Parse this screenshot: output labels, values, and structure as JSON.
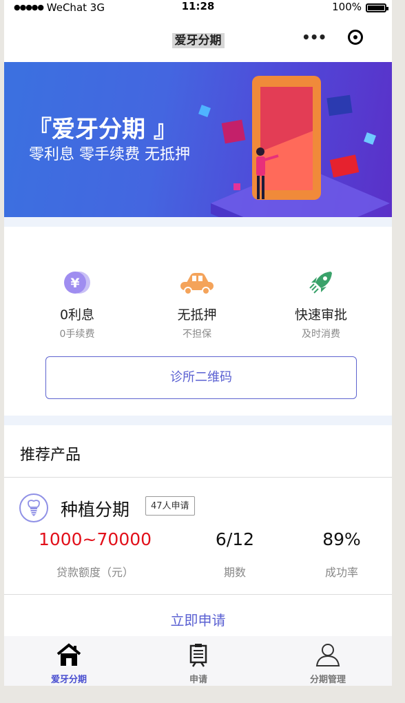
{
  "status_bar": {
    "signal_dots": "●●●●●",
    "carrier": "WeChat 3G",
    "time": "11:28",
    "battery": "100%"
  },
  "nav": {
    "title": "爱牙分期",
    "more_icon": "more-dots-icon",
    "close_icon": "close-circle-icon"
  },
  "banner": {
    "title": "『爱牙分期 』",
    "subtitle": "零利息 零手续费 无抵押",
    "colors": {
      "from": "#3b71e0",
      "to": "#5a30c8"
    }
  },
  "features": [
    {
      "icon": "yen-coin-icon",
      "title": "0利息",
      "subtitle": "0手续费",
      "color": "#9f8df0"
    },
    {
      "icon": "car-icon",
      "title": "无抵押",
      "subtitle": "不担保",
      "color": "#f4a35a"
    },
    {
      "icon": "rocket-icon",
      "title": "快速审批",
      "subtitle": "及时消费",
      "color": "#3aa26a"
    }
  ],
  "qr_button": {
    "label": "诊所二维码"
  },
  "recommend": {
    "title": "推荐产品",
    "product": {
      "icon": "tooth-icon",
      "name": "种植分期",
      "badge": "47人申请",
      "stats": [
        {
          "value": "1000~70000",
          "label": "贷款额度（元）"
        },
        {
          "value": "6/12",
          "label": "期数"
        },
        {
          "value": "89%",
          "label": "成功率"
        }
      ],
      "apply_label": "立即申请"
    }
  },
  "tabbar": {
    "active_color": "#4a4fd0",
    "items": [
      {
        "label": "爱牙分期",
        "icon": "home-icon",
        "active": true
      },
      {
        "label": "申请",
        "icon": "clipboard-icon",
        "active": false
      },
      {
        "label": "分期管理",
        "icon": "user-icon",
        "active": false
      }
    ]
  }
}
